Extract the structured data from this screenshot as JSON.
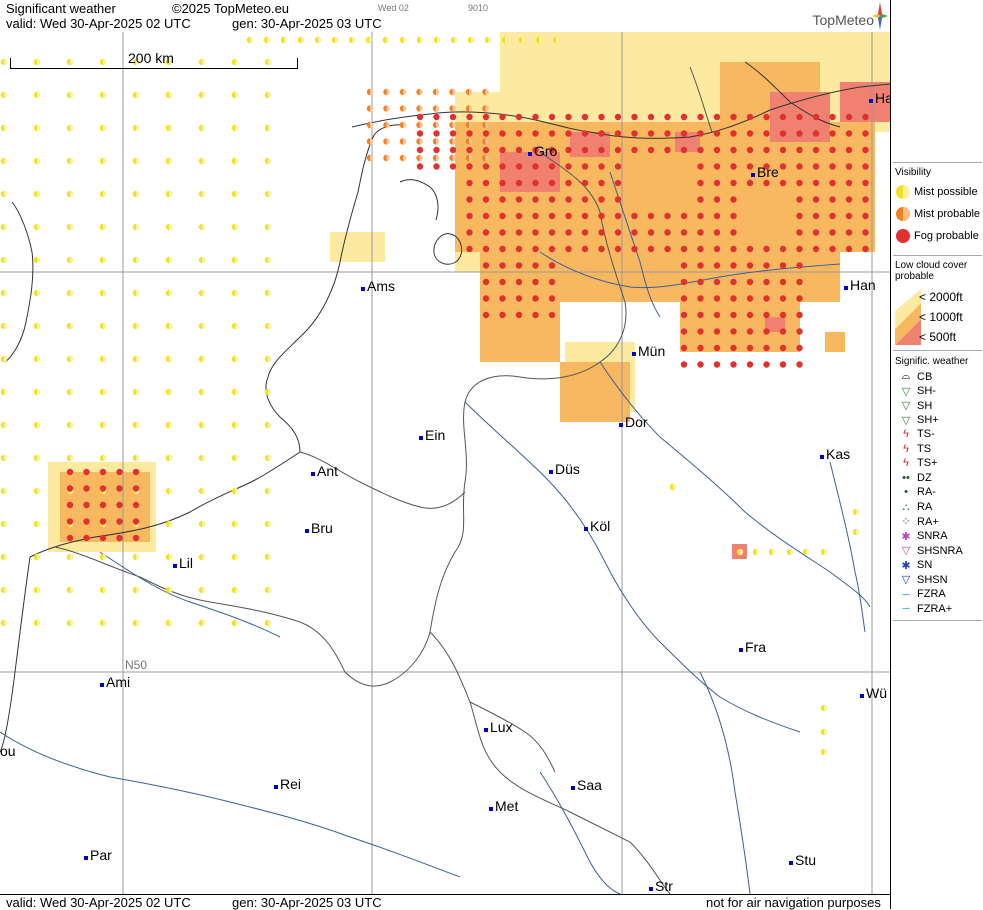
{
  "header": {
    "title": "Significant weather",
    "copyright": "©2025 TopMeteo.eu",
    "small1": "Wed 02",
    "small2": "9010",
    "valid": "valid:  Wed  30-Apr-2025  02 UTC",
    "generated": "gen:  30-Apr-2025  03 UTC",
    "logo": "TopMeteo"
  },
  "scale_label": "200 km",
  "lat_label": "N50",
  "cities": [
    {
      "name": "Gro"
    },
    {
      "name": "Bre"
    },
    {
      "name": "Ha"
    },
    {
      "name": "Ams"
    },
    {
      "name": "Han"
    },
    {
      "name": "Mün"
    },
    {
      "name": "Dor"
    },
    {
      "name": "Ein"
    },
    {
      "name": "Kas"
    },
    {
      "name": "Ant"
    },
    {
      "name": "Düs"
    },
    {
      "name": "Köl"
    },
    {
      "name": "Bru"
    },
    {
      "name": "Lil"
    },
    {
      "name": "Fra"
    },
    {
      "name": "Ami"
    },
    {
      "name": "Wü"
    },
    {
      "name": "Lux"
    },
    {
      "name": "ou"
    },
    {
      "name": "Rei"
    },
    {
      "name": "Saa"
    },
    {
      "name": "Met"
    },
    {
      "name": "Par"
    },
    {
      "name": "Stu"
    },
    {
      "name": "Str"
    }
  ],
  "footer": {
    "valid": "valid:  Wed  30-Apr-2025  02 UTC",
    "generated": "gen:  30-Apr-2025 03 UTC",
    "note": "not for air navigation purposes"
  },
  "legend": {
    "visibility_title": "Visibility",
    "visibility": [
      "Mist possible",
      "Mist probable",
      "Fog probable"
    ],
    "cloud_title": "Low cloud cover probable",
    "cloud": [
      "< 2000ft",
      "< 1000ft",
      "<   500ft"
    ],
    "sigwx_title": "Signific. weather",
    "sigwx": [
      "CB",
      "SH-",
      "SH",
      "SH+",
      "TS-",
      "TS",
      "TS+",
      "DZ",
      "RA-",
      "RA",
      "RA+",
      "SNRA",
      "SHSNRA",
      "SN",
      "SHSN",
      "FZRA",
      "FZRA+"
    ]
  },
  "colors": {
    "cloud2000": "#fbeaa0",
    "cloud1000": "#f7b860",
    "cloud500": "#f08070",
    "mist_possible": "#f5e020",
    "mist_probable": "#f08020",
    "fog": "#e03030",
    "city_marker": "#0000cc"
  }
}
